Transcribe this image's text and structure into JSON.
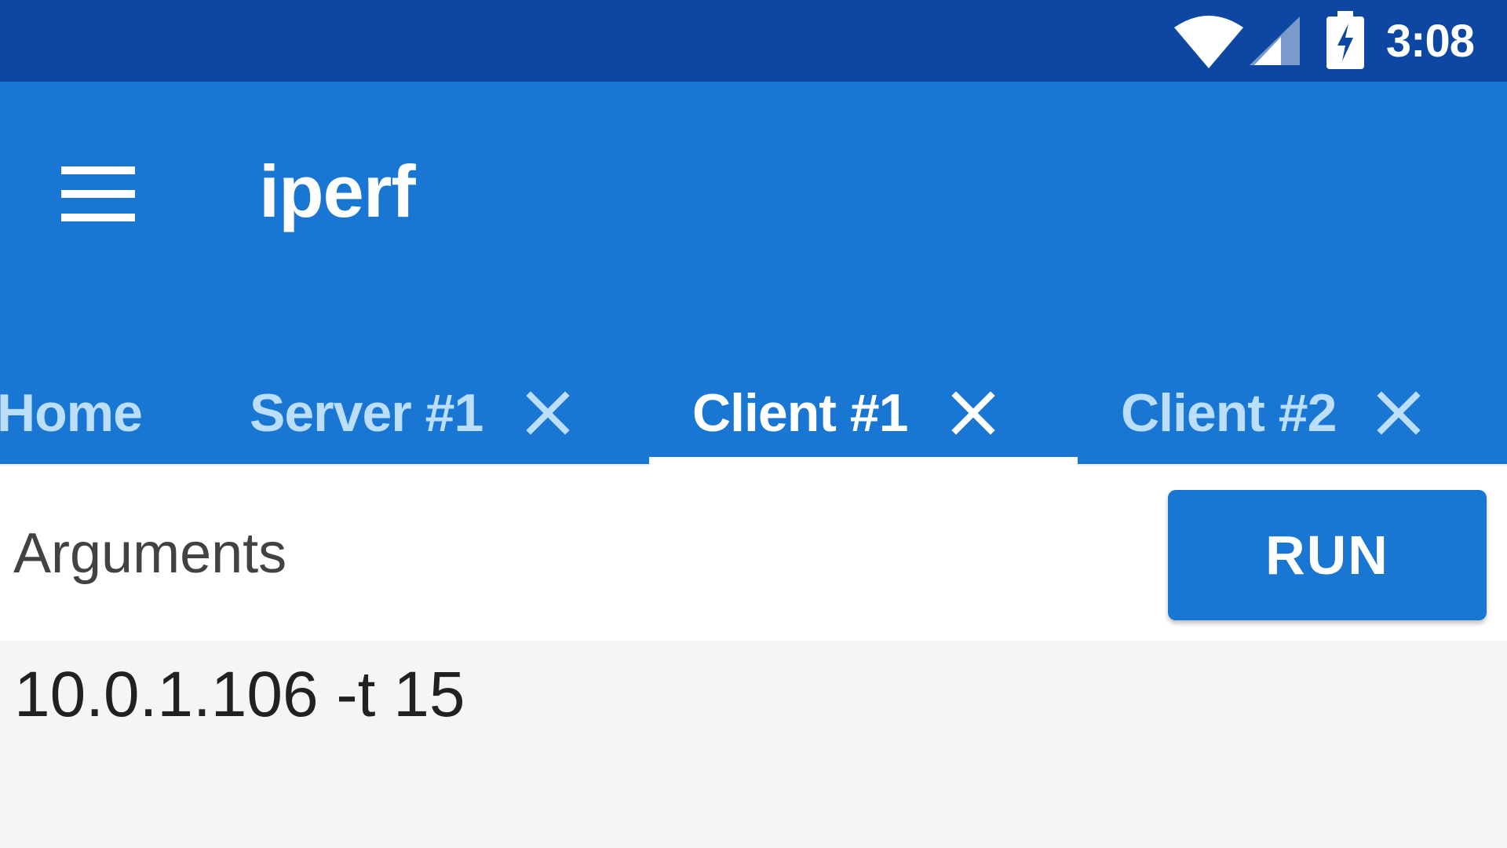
{
  "status_bar": {
    "time": "3:08",
    "icons": [
      "wifi-icon",
      "cellular-signal-icon",
      "battery-charging-icon"
    ],
    "background": "#0d47a1"
  },
  "app_bar": {
    "title": "iperf",
    "menu_icon": "hamburger-menu-icon",
    "background": "#1976d2"
  },
  "tabs": [
    {
      "label": "Home",
      "closable": false,
      "selected": false
    },
    {
      "label": "Server #1",
      "closable": true,
      "selected": false
    },
    {
      "label": "Client #1",
      "closable": true,
      "selected": true
    },
    {
      "label": "Client #2",
      "closable": true,
      "selected": false
    }
  ],
  "colors": {
    "tab_selected": "#ffffff",
    "tab_unselected": "#bbdefb",
    "accent": "#1976d2"
  },
  "arguments": {
    "label": "Arguments",
    "value": "10.0.1.106 -t 15"
  },
  "run_button": {
    "label": "RUN"
  }
}
